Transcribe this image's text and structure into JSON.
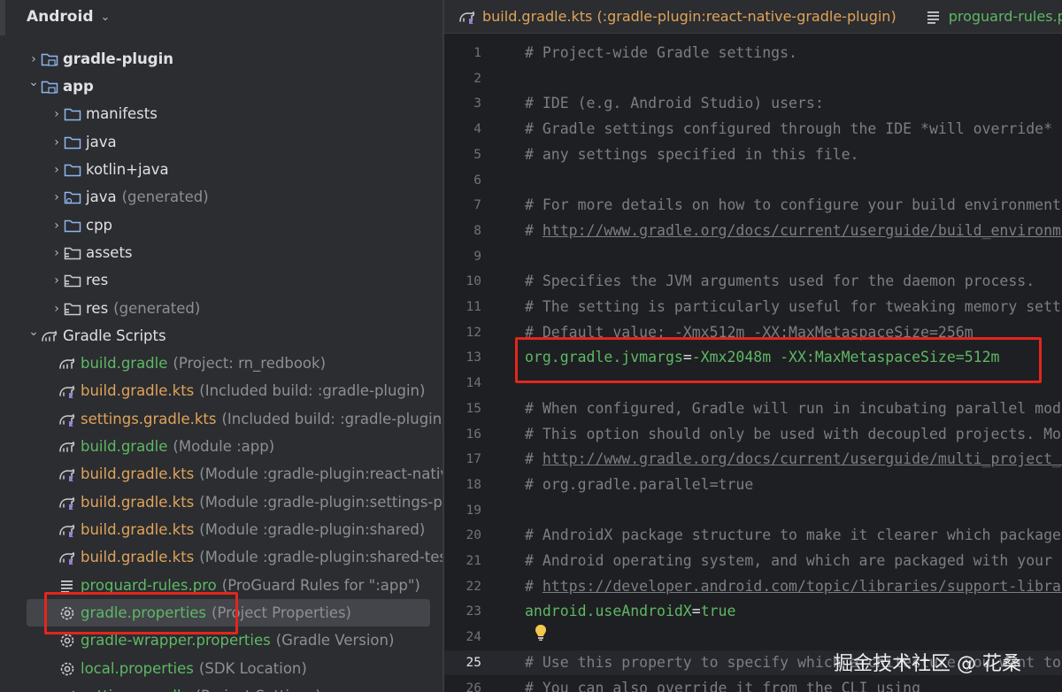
{
  "project_panel": {
    "title": "Android",
    "rows": [
      {
        "label": "gradle-plugin",
        "hint": "",
        "style": "bold",
        "icon": "module-folder-icon"
      },
      {
        "label": "app",
        "hint": "",
        "style": "bold",
        "icon": "module-folder-icon"
      },
      {
        "label": "manifests",
        "hint": "",
        "style": "normal",
        "icon": "folder-icon"
      },
      {
        "label": "java",
        "hint": "",
        "style": "normal",
        "icon": "folder-icon"
      },
      {
        "label": "kotlin+java",
        "hint": "",
        "style": "normal",
        "icon": "folder-icon"
      },
      {
        "label": "java",
        "hint": "(generated)",
        "style": "normal",
        "icon": "generated-folder-icon"
      },
      {
        "label": "cpp",
        "hint": "",
        "style": "normal",
        "icon": "folder-icon"
      },
      {
        "label": "assets",
        "hint": "",
        "style": "normal",
        "icon": "resource-folder-icon"
      },
      {
        "label": "res",
        "hint": "",
        "style": "normal",
        "icon": "resource-folder-icon"
      },
      {
        "label": "res",
        "hint": "(generated)",
        "style": "normal",
        "icon": "resource-folder-icon"
      },
      {
        "label": "Gradle Scripts",
        "hint": "",
        "style": "normal",
        "icon": "gradle-elephant-icon"
      },
      {
        "label": "build.gradle",
        "hint": "(Project: rn_redbook)",
        "style": "green",
        "icon": "gradle-elephant-icon"
      },
      {
        "label": "build.gradle.kts",
        "hint": "(Included build: :gradle-plugin)",
        "style": "orange",
        "icon": "gradle-kts-icon"
      },
      {
        "label": "settings.gradle.kts",
        "hint": "(Included build: :gradle-plugin)",
        "style": "orange",
        "icon": "gradle-kts-icon"
      },
      {
        "label": "build.gradle",
        "hint": "(Module :app)",
        "style": "green",
        "icon": "gradle-elephant-icon"
      },
      {
        "label": "build.gradle.kts",
        "hint": "(Module :gradle-plugin:react-native-gradle-plugin)",
        "style": "orange",
        "icon": "gradle-kts-icon"
      },
      {
        "label": "build.gradle.kts",
        "hint": "(Module :gradle-plugin:settings-plugin)",
        "style": "orange",
        "icon": "gradle-kts-icon"
      },
      {
        "label": "build.gradle.kts",
        "hint": "(Module :gradle-plugin:shared)",
        "style": "orange",
        "icon": "gradle-kts-icon"
      },
      {
        "label": "build.gradle.kts",
        "hint": "(Module :gradle-plugin:shared-testutils)",
        "style": "orange",
        "icon": "gradle-kts-icon"
      },
      {
        "label": "proguard-rules.pro",
        "hint": "(ProGuard Rules for \":app\")",
        "style": "green",
        "icon": "text-file-icon"
      },
      {
        "label": "gradle.properties",
        "hint": "(Project Properties)",
        "style": "green",
        "icon": "properties-gear-icon"
      },
      {
        "label": "gradle-wrapper.properties",
        "hint": "(Gradle Version)",
        "style": "green",
        "icon": "properties-gear-icon"
      },
      {
        "label": "local.properties",
        "hint": "(SDK Location)",
        "style": "green",
        "icon": "properties-gear-icon"
      },
      {
        "label": "settings.gradle",
        "hint": "(Project Settings)",
        "style": "green",
        "icon": "gradle-elephant-icon"
      }
    ]
  },
  "editor": {
    "tabs": [
      {
        "label": "build.gradle.kts (:gradle-plugin:react-native-gradle-plugin)",
        "icon": "gradle-kts-icon",
        "color": "#e0a35a"
      },
      {
        "label": "proguard-rules.pro",
        "icon": "text-file-icon",
        "color": "#5fb865"
      }
    ],
    "current_line": 25,
    "lines": [
      {
        "n": "1",
        "type": "comment",
        "text": "# Project-wide Gradle settings."
      },
      {
        "n": "2",
        "type": "blank",
        "text": ""
      },
      {
        "n": "3",
        "type": "comment",
        "text": "# IDE (e.g. Android Studio) users:"
      },
      {
        "n": "4",
        "type": "comment",
        "text": "# Gradle settings configured through the IDE *will override*"
      },
      {
        "n": "5",
        "type": "comment",
        "text": "# any settings specified in this file."
      },
      {
        "n": "6",
        "type": "blank",
        "text": ""
      },
      {
        "n": "7",
        "type": "comment",
        "text": "# For more details on how to configure your build environment visit"
      },
      {
        "n": "8",
        "type": "link",
        "prefix": "# ",
        "text": "http://www.gradle.org/docs/current/userguide/build_environment.html"
      },
      {
        "n": "9",
        "type": "blank",
        "text": ""
      },
      {
        "n": "10",
        "type": "comment",
        "text": "# Specifies the JVM arguments used for the daemon process."
      },
      {
        "n": "11",
        "type": "comment",
        "text": "# The setting is particularly useful for tweaking memory settings."
      },
      {
        "n": "12",
        "type": "comment",
        "text": "# Default value: -Xmx512m -XX:MaxMetaspaceSize=256m"
      },
      {
        "n": "13",
        "type": "prop",
        "key": "org.gradle.jvmargs",
        "value": "-Xmx2048m -XX:MaxMetaspaceSize=512m"
      },
      {
        "n": "14",
        "type": "blank",
        "text": ""
      },
      {
        "n": "15",
        "type": "comment",
        "text": "# When configured, Gradle will run in incubating parallel mode."
      },
      {
        "n": "16",
        "type": "comment",
        "text": "# This option should only be used with decoupled projects. More details, visit"
      },
      {
        "n": "17",
        "type": "link",
        "prefix": "# ",
        "text": "http://www.gradle.org/docs/current/userguide/multi_project_builds.html"
      },
      {
        "n": "18",
        "type": "comment",
        "text": "# org.gradle.parallel=true"
      },
      {
        "n": "19",
        "type": "blank",
        "text": ""
      },
      {
        "n": "20",
        "type": "comment",
        "text": "# AndroidX package structure to make it clearer which packages are bundled with the"
      },
      {
        "n": "21",
        "type": "comment",
        "text": "# Android operating system, and which are packaged with your app's APK"
      },
      {
        "n": "22",
        "type": "link",
        "prefix": "# ",
        "text": "https://developer.android.com/topic/libraries/support-library/androidx-rn"
      },
      {
        "n": "23",
        "type": "prop",
        "key": "android.useAndroidX",
        "value": "true"
      },
      {
        "n": "24",
        "type": "blank",
        "text": ""
      },
      {
        "n": "25",
        "type": "comment",
        "text": "# Use this property to specify which architecture you want to build."
      },
      {
        "n": "26",
        "type": "comment",
        "text": "# You can also override it from the CLI using"
      }
    ]
  },
  "watermark": "掘金技术社区 @ 花桑",
  "colors": {
    "highlight_box": "#e2261d",
    "green": "#5fb865",
    "orange": "#e0a35a",
    "comment": "#7a7e85"
  }
}
